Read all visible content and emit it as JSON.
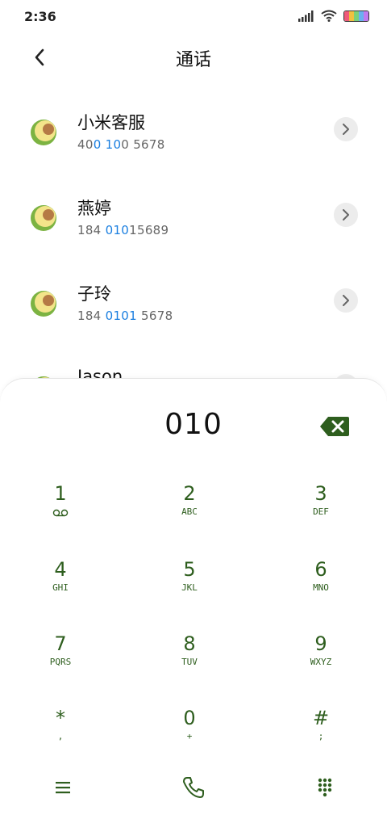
{
  "status": {
    "time": "2:36"
  },
  "header": {
    "title": "通话"
  },
  "contacts": [
    {
      "name": "小米客服",
      "num_pre": "40",
      "num_hl1": "0",
      "num_mid": " ",
      "num_hl2": "10",
      "num_post": "0 5678"
    },
    {
      "name": "燕婷",
      "num_pre": "184 ",
      "num_hl1": "010",
      "num_mid": "",
      "num_hl2": "",
      "num_post": "15689"
    },
    {
      "name": "子玲",
      "num_pre": "184 ",
      "num_hl1": "0101",
      "num_mid": "",
      "num_hl2": "",
      "num_post": " 5678"
    },
    {
      "name": "Jason"
    }
  ],
  "dialer": {
    "number": "010",
    "keys": [
      {
        "digit": "1",
        "letters": ""
      },
      {
        "digit": "2",
        "letters": "ABC"
      },
      {
        "digit": "3",
        "letters": "DEF"
      },
      {
        "digit": "4",
        "letters": "GHI"
      },
      {
        "digit": "5",
        "letters": "JKL"
      },
      {
        "digit": "6",
        "letters": "MNO"
      },
      {
        "digit": "7",
        "letters": "PQRS"
      },
      {
        "digit": "8",
        "letters": "TUV"
      },
      {
        "digit": "9",
        "letters": "WXYZ"
      },
      {
        "digit": "*",
        "letters": ","
      },
      {
        "digit": "0",
        "letters": "+"
      },
      {
        "digit": "#",
        "letters": ";"
      }
    ]
  },
  "colors": {
    "accent": "#2e5e1e",
    "highlight": "#1b7fe0"
  },
  "icons": [
    "back-icon",
    "chevron-right-icon",
    "voicemail-icon",
    "backspace-icon",
    "menu-icon",
    "phone-icon",
    "dialpad-icon"
  ]
}
